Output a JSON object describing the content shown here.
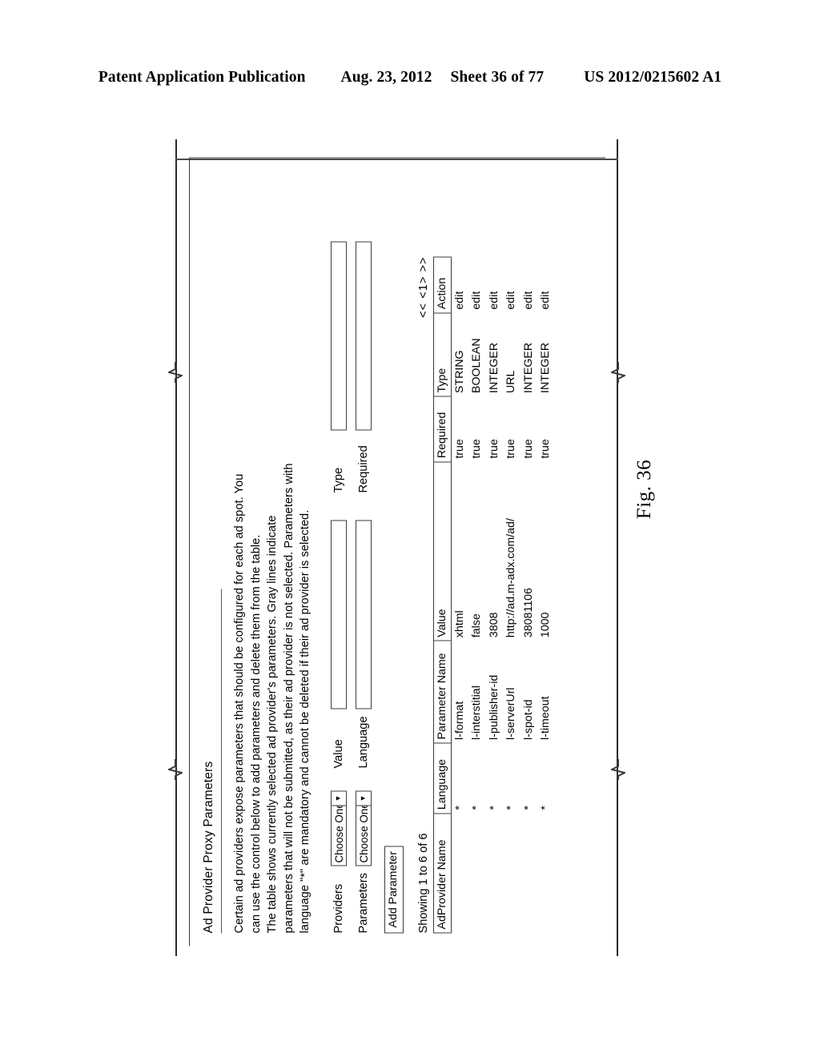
{
  "page_header": {
    "publication": "Patent Application Publication",
    "date": "Aug. 23, 2012",
    "sheet": "Sheet 36 of 77",
    "patent_number": "US 2012/0215602 A1"
  },
  "figure": {
    "caption": "Fig. 36"
  },
  "panel": {
    "title": "Ad Provider Proxy Parameters",
    "description": "Certain ad providers expose parameters that should be configured for each ad spot.  You\ncan use the control below to add parameters and delete them from the table.\nThe table shows currently selected ad provider's parameters.  Gray lines indicate\nparameters that will not be submitted, as their ad provider is not selected.  Parameters with\nlanguage \"*\" are mandatory and cannot be deleted if their ad provider is selected."
  },
  "form": {
    "providers": {
      "label": "Providers",
      "select_value": "Choose One",
      "arrow_icon": "chevron-down-icon"
    },
    "parameters": {
      "label": "Parameters",
      "select_value": "Choose One",
      "arrow_icon": "chevron-down-icon"
    },
    "value": {
      "label": "Value",
      "input_value": ""
    },
    "type": {
      "label": "Type",
      "input_value": ""
    },
    "language": {
      "label": "Language",
      "input_value": ""
    },
    "required": {
      "label": "Required",
      "input_value": ""
    },
    "add_button": "Add Parameter"
  },
  "table": {
    "showing": "Showing 1 to 6 of 6",
    "pagination": "<< <1> >>",
    "columns": [
      "AdProvider Name",
      "Language",
      "Parameter Name",
      "Value",
      "Required",
      "Type",
      "Action"
    ],
    "rows": [
      {
        "provider": "",
        "language": "*",
        "parameter_name": "l-format",
        "value": "xhtml",
        "required": "true",
        "type": "STRING",
        "action": "edit"
      },
      {
        "provider": "",
        "language": "*",
        "parameter_name": "l-interstitial",
        "value": "false",
        "required": "true",
        "type": "BOOLEAN",
        "action": "edit"
      },
      {
        "provider": "",
        "language": "*",
        "parameter_name": "l-publisher-id",
        "value": "3808",
        "required": "true",
        "type": "INTEGER",
        "action": "edit"
      },
      {
        "provider": "",
        "language": "*",
        "parameter_name": "l-serverUrl",
        "value": "http://ad.m-adx.com/ad/",
        "required": "true",
        "type": "URL",
        "action": "edit"
      },
      {
        "provider": "",
        "language": "*",
        "parameter_name": "l-spot-id",
        "value": "38081106",
        "required": "true",
        "type": "INTEGER",
        "action": "edit"
      },
      {
        "provider": "",
        "language": "*",
        "parameter_name": "l-timeout",
        "value": "1000",
        "required": "true",
        "type": "INTEGER",
        "action": "edit"
      }
    ]
  }
}
